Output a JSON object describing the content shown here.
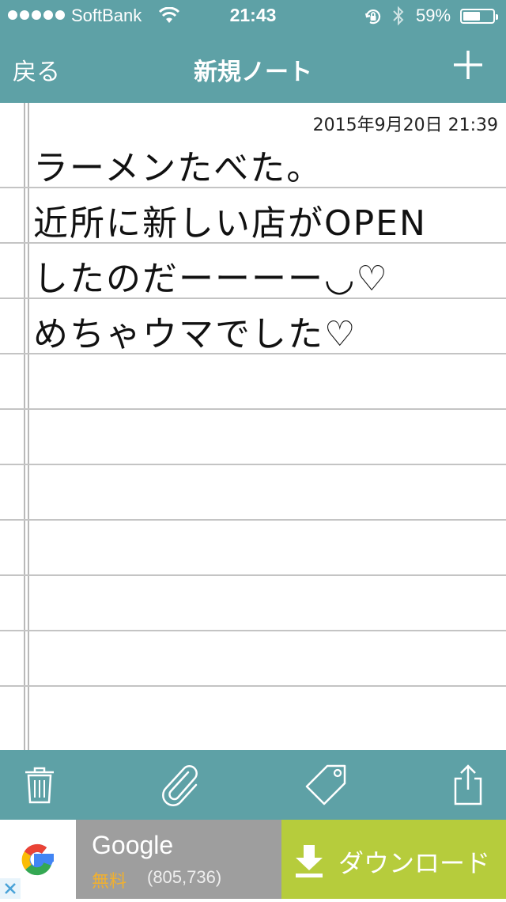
{
  "status_bar": {
    "carrier": "SoftBank",
    "time": "21:43",
    "battery_percent": "59%",
    "battery_level": 0.59,
    "icons": [
      "signal-dots-icon",
      "wifi-icon",
      "rotation-lock-icon",
      "bluetooth-icon",
      "battery-icon"
    ]
  },
  "nav": {
    "back_label": "戻る",
    "title": "新規ノート",
    "add_icon": "plus-icon"
  },
  "note": {
    "date": "2015年9月20日 21:39",
    "lines": [
      "ラーメンたべた。",
      "近所に新しい店がOPEN",
      "したのだーーーー◡♡",
      "めちゃウマでした♡"
    ],
    "style": "handwritten"
  },
  "toolbar": {
    "icons": [
      "trash-icon",
      "paperclip-icon",
      "tag-icon",
      "share-icon"
    ]
  },
  "ad": {
    "app_name": "Google",
    "price": "無料",
    "review_count": "(805,736)",
    "download_label": "ダウンロード",
    "icons": [
      "google-logo-icon",
      "close-icon",
      "download-icon"
    ]
  },
  "colors": {
    "teal": "#5ea1a6",
    "ad_gray": "#9e9e9e",
    "ad_green": "#b6cc3c",
    "ad_price": "#f0b030"
  }
}
